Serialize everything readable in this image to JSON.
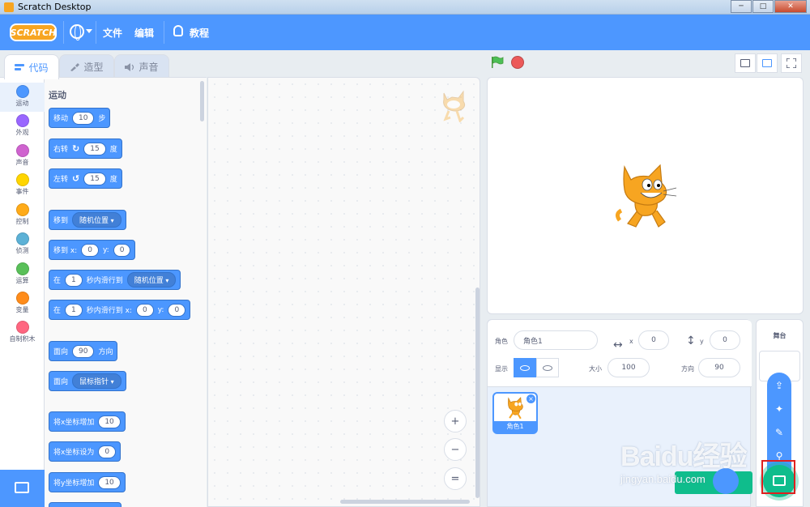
{
  "window": {
    "title": "Scratch Desktop",
    "buttons": [
      "─",
      "□",
      "✕"
    ]
  },
  "menubar": {
    "logo": "SCRATCH",
    "file": "文件",
    "edit": "编辑",
    "tutorials": "教程"
  },
  "tabs": [
    {
      "label": "代码"
    },
    {
      "label": "造型"
    },
    {
      "label": "声音"
    }
  ],
  "categories": [
    {
      "label": "运动",
      "color": "#4c97ff"
    },
    {
      "label": "外观",
      "color": "#9966ff"
    },
    {
      "label": "声音",
      "color": "#cf63cf"
    },
    {
      "label": "事件",
      "color": "#ffd500"
    },
    {
      "label": "控制",
      "color": "#ffab19"
    },
    {
      "label": "侦测",
      "color": "#5cb1d6"
    },
    {
      "label": "运算",
      "color": "#59c059"
    },
    {
      "label": "变量",
      "color": "#ff8c1a"
    },
    {
      "label": "自制积木",
      "color": "#ff6680"
    }
  ],
  "palette": {
    "title": "运动",
    "blocks": {
      "move": {
        "a": "移动",
        "v": "10",
        "b": "步"
      },
      "turn_right": {
        "a": "右转",
        "icon": "↻",
        "v": "15",
        "b": "度"
      },
      "turn_left": {
        "a": "左转",
        "icon": "↺",
        "v": "15",
        "b": "度"
      },
      "goto": {
        "a": "移到",
        "dd": "随机位置"
      },
      "goto_xy": {
        "a": "移到 x:",
        "x": "0",
        "yl": "y:",
        "y": "0"
      },
      "glide": {
        "a": "在",
        "v": "1",
        "b": "秒内滑行到",
        "dd": "随机位置"
      },
      "glide_xy": {
        "a": "在",
        "v": "1",
        "b": "秒内滑行到 x:",
        "x": "0",
        "yl": "y:",
        "y": "0"
      },
      "point_dir": {
        "a": "面向",
        "v": "90",
        "b": "方向"
      },
      "point_towards": {
        "a": "面向",
        "dd": "鼠标指针"
      },
      "change_x": {
        "a": "将x坐标增加",
        "v": "10"
      },
      "set_x": {
        "a": "将x坐标设为",
        "v": "0"
      },
      "change_y": {
        "a": "将y坐标增加",
        "v": "10"
      }
    }
  },
  "zoom": {
    "in": "+",
    "out": "−",
    "reset": "="
  },
  "sprite_info": {
    "sprite_label": "角色",
    "sprite_name": "角色1",
    "x_label": "x",
    "x": "0",
    "y_label": "y",
    "y": "0",
    "show_label": "显示",
    "size_label": "大小",
    "size": "100",
    "direction_label": "方向",
    "direction": "90"
  },
  "sprite_list": [
    {
      "name": "角色1"
    }
  ],
  "stage_selector": {
    "title": "舞台"
  },
  "watermark": {
    "main": "Baidu经验",
    "url": "jingyan.baidu.com"
  }
}
